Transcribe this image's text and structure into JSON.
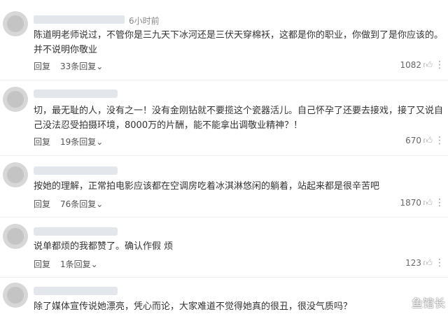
{
  "comments": [
    {
      "time": "6小时前",
      "text": "陈道明老师说过，不管你是三九天下冰河还是三伏天穿棉袄，这都是你的职业，你做到了是你应该的。并不说明你敬业",
      "reply_label": "回复",
      "replies": "33条回复",
      "likes": "1082"
    },
    {
      "text": "切，最无耻的人，没有之一！没有金刚钻就不要揽这个瓷器活儿。自己怀孕了还要去接戏，接了又说自己没法忍受拍摄环境，8000万的片酬，能不能拿出调敬业精神？！",
      "reply_label": "回复",
      "replies": "19条回复",
      "likes": "670"
    },
    {
      "text": "按她的理解，正常拍电影应该都在空调房吃着冰淇淋悠闲的躺着，站起来都是很辛苦吧",
      "reply_label": "回复",
      "replies": "76条回复",
      "likes": "1870"
    },
    {
      "text": "说单都烦的我都赞了。确认作假 烦",
      "reply_label": "回复",
      "replies": "1条回复",
      "likes": "123"
    },
    {
      "text": "除了媒体宣传说她漂亮，凭心而论，大家难道不觉得她真的很丑，很没气质吗？"
    }
  ],
  "icons": {
    "thumb": "thumbs-up-icon",
    "more": "more-icon",
    "chevron": "chevron-down-icon"
  },
  "watermark": "鱼馆长"
}
